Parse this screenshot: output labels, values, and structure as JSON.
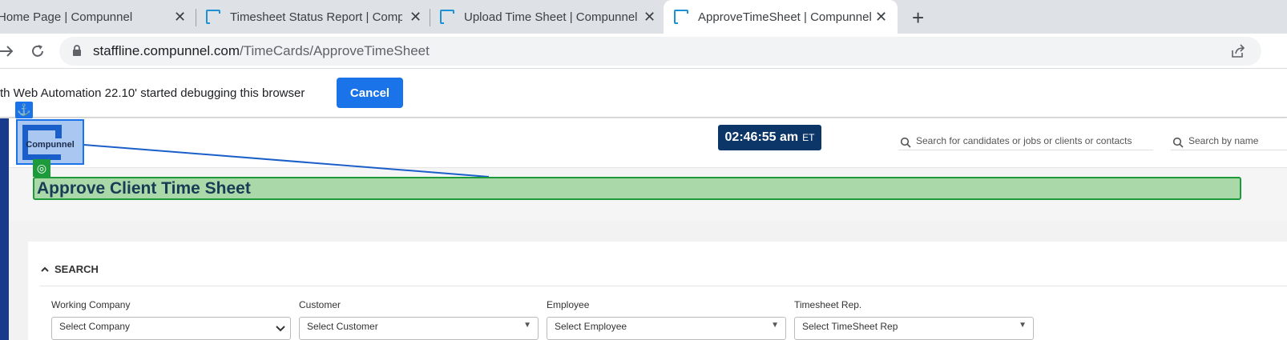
{
  "browser": {
    "tabs": [
      {
        "title": "Home Page | Compunnel",
        "active": false
      },
      {
        "title": "Timesheet Status Report | Compunnel",
        "active": false
      },
      {
        "title": "Upload Time Sheet | Compunnel",
        "active": false
      },
      {
        "title": "ApproveTimeSheet | Compunnel",
        "active": true
      }
    ],
    "url_host": "staffline.compunnel.com",
    "url_path": "/TimeCards/ApproveTimeSheet"
  },
  "infobar": {
    "message": "th Web Automation 22.10' started debugging this browser",
    "cancel_label": "Cancel"
  },
  "header": {
    "logo_text": "Compunnel",
    "clock_time": "02:46:55 am",
    "clock_tz": "ET",
    "search_main_placeholder": "Search for candidates or jobs or clients or contacts",
    "search_name_placeholder": "Search by name"
  },
  "page": {
    "title": "Approve Client Time Sheet"
  },
  "search_section": {
    "heading": "SEARCH",
    "fields": [
      {
        "label": "Working Company",
        "placeholder": "Select Company"
      },
      {
        "label": "Customer",
        "placeholder": "Select Customer"
      },
      {
        "label": "Employee",
        "placeholder": "Select Employee"
      },
      {
        "label": "Timesheet Rep.",
        "placeholder": "Select TimeSheet Rep"
      }
    ]
  },
  "colors": {
    "chrome_tabstrip": "#dee1e6",
    "cancel_button": "#1a73e8",
    "clock_bg": "#0c3668",
    "highlight_green": "#abd8a9",
    "left_nav": "#173a8c"
  }
}
